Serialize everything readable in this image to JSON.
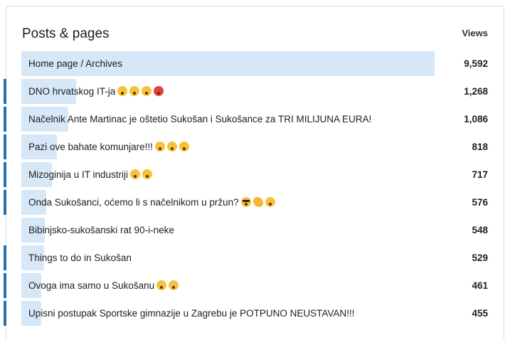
{
  "header": {
    "title": "Posts & pages",
    "column": "Views"
  },
  "accent_color": "#2271b1",
  "bar_color": "#d6e7f7",
  "max_views": 9592,
  "rows": [
    {
      "label": "Home page / Archives",
      "views": "9,592",
      "value": 9592,
      "accent": false,
      "emojis": []
    },
    {
      "label": "DNO hrvatskog IT-ja",
      "views": "1,268",
      "value": 1268,
      "accent": true,
      "emojis": [
        "astonished-face-icon",
        "rolling-eyes-icon",
        "nerd-face-icon",
        "angry-face-icon"
      ]
    },
    {
      "label": "Načelnik Ante Martinac je oštetio Sukošan i Sukošance za TRI MILIJUNA EURA!",
      "views": "1,086",
      "value": 1086,
      "accent": true,
      "emojis": []
    },
    {
      "label": "Pazi ove bahate komunjare!!!",
      "views": "818",
      "value": 818,
      "accent": true,
      "emojis": [
        "astonished-face-icon",
        "astonished-face-icon",
        "astonished-face-icon"
      ]
    },
    {
      "label": "Mizoginija u IT industriji",
      "views": "717",
      "value": 717,
      "accent": true,
      "emojis": [
        "astonished-face-icon",
        "rolling-eyes-icon"
      ]
    },
    {
      "label": "Onda Sukošanci, oćemo li s načelnikom u pržun?",
      "views": "576",
      "value": 576,
      "accent": true,
      "emojis": [
        "sunglasses-face-icon",
        "flexed-biceps-icon",
        "rofl-face-icon"
      ]
    },
    {
      "label": "Bibinjsko-sukošanski rat 90-i-neke",
      "views": "548",
      "value": 548,
      "accent": false,
      "emojis": []
    },
    {
      "label": "Things to do in Sukošan",
      "views": "529",
      "value": 529,
      "accent": true,
      "emojis": []
    },
    {
      "label": "Ovoga ima samo u Sukošanu",
      "views": "461",
      "value": 461,
      "accent": true,
      "emojis": [
        "rofl-face-icon",
        "thinking-face-icon"
      ]
    },
    {
      "label": "Upisni postupak Sportske gimnazije u Zagrebu je POTPUNO NEUSTAVAN!!!",
      "views": "455",
      "value": 455,
      "accent": true,
      "emojis": []
    }
  ]
}
